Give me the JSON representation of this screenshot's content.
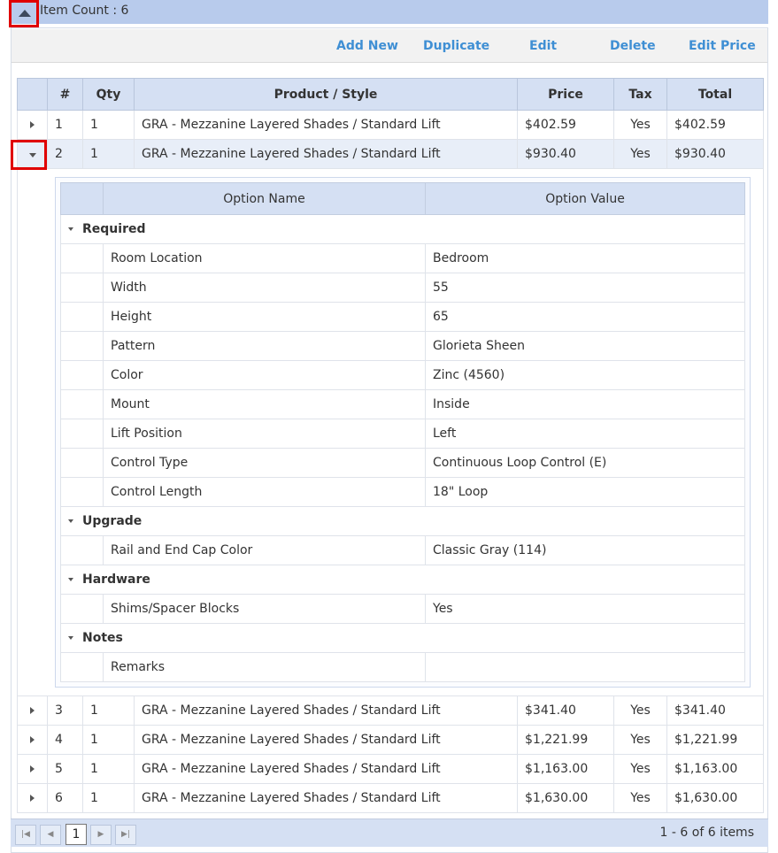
{
  "header": {
    "item_count": "Item Count : 6",
    "collapse_icon": "triangle-up-icon"
  },
  "toolbar": {
    "add_new": "Add New",
    "duplicate": "Duplicate",
    "edit": "Edit",
    "delete": "Delete",
    "edit_price": "Edit Price"
  },
  "grid": {
    "columns": [
      "#",
      "Qty",
      "Product / Style",
      "Price",
      "Tax",
      "Total"
    ],
    "rows": [
      {
        "num": "1",
        "qty": "1",
        "product": "GRA - Mezzanine Layered Shades / Standard Lift",
        "price": "$402.59",
        "tax": "Yes",
        "total": "$402.59"
      },
      {
        "num": "2",
        "qty": "1",
        "product": "GRA - Mezzanine Layered Shades / Standard Lift",
        "price": "$930.40",
        "tax": "Yes",
        "total": "$930.40"
      },
      {
        "num": "3",
        "qty": "1",
        "product": "GRA - Mezzanine Layered Shades / Standard Lift",
        "price": "$341.40",
        "tax": "Yes",
        "total": "$341.40"
      },
      {
        "num": "4",
        "qty": "1",
        "product": "GRA - Mezzanine Layered Shades / Standard Lift",
        "price": "$1,221.99",
        "tax": "Yes",
        "total": "$1,221.99"
      },
      {
        "num": "5",
        "qty": "1",
        "product": "GRA - Mezzanine Layered Shades / Standard Lift",
        "price": "$1,163.00",
        "tax": "Yes",
        "total": "$1,163.00"
      },
      {
        "num": "6",
        "qty": "1",
        "product": "GRA - Mezzanine Layered Shades / Standard Lift",
        "price": "$1,630.00",
        "tax": "Yes",
        "total": "$1,630.00"
      }
    ]
  },
  "detail": {
    "col_name": "Option Name",
    "col_value": "Option Value",
    "groups": {
      "required": {
        "label": "Required",
        "items": [
          {
            "name": "Room Location",
            "value": "Bedroom"
          },
          {
            "name": "Width",
            "value": "55"
          },
          {
            "name": "Height",
            "value": "65"
          },
          {
            "name": "Pattern",
            "value": "Glorieta Sheen"
          },
          {
            "name": "Color",
            "value": "Zinc (4560)"
          },
          {
            "name": "Mount",
            "value": "Inside"
          },
          {
            "name": "Lift Position",
            "value": "Left"
          },
          {
            "name": "Control Type",
            "value": "Continuous Loop Control (E)"
          },
          {
            "name": "Control Length",
            "value": "18\" Loop"
          }
        ]
      },
      "upgrade": {
        "label": "Upgrade",
        "items": [
          {
            "name": "Rail and End Cap Color",
            "value": "Classic Gray (114)"
          }
        ]
      },
      "hardware": {
        "label": "Hardware",
        "items": [
          {
            "name": "Shims/Spacer Blocks",
            "value": "Yes"
          }
        ]
      },
      "notes": {
        "label": "Notes",
        "items": [
          {
            "name": "Remarks",
            "value": ""
          }
        ]
      }
    }
  },
  "pager": {
    "current_page": "1",
    "info": "1 - 6 of 6 items"
  }
}
